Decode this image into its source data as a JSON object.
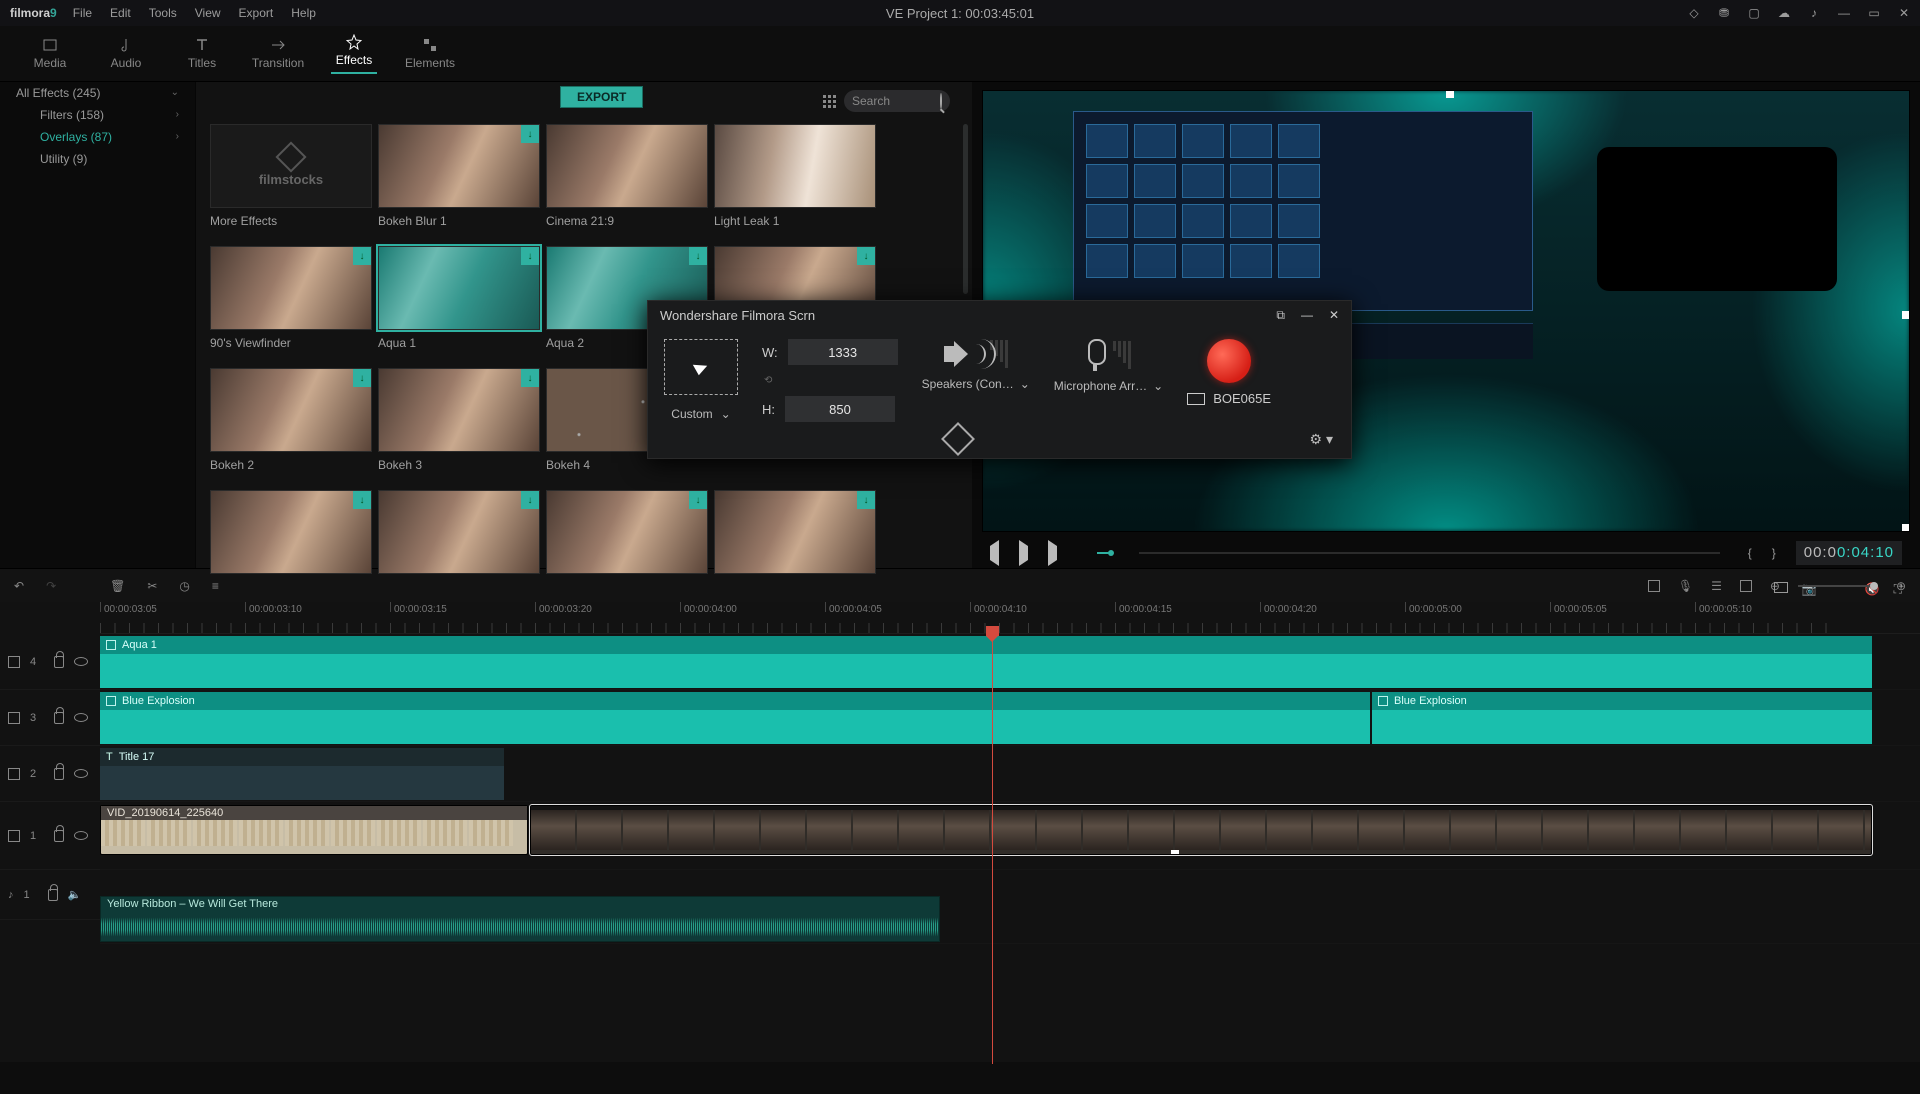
{
  "app": {
    "logo_a": "filmora",
    "logo_b": "9",
    "title": "VE Project 1:  00:03:45:01"
  },
  "menu": [
    "File",
    "Edit",
    "Tools",
    "View",
    "Export",
    "Help"
  ],
  "modes": [
    {
      "label": "Media"
    },
    {
      "label": "Audio"
    },
    {
      "label": "Titles"
    },
    {
      "label": "Transition"
    },
    {
      "label": "Effects"
    },
    {
      "label": "Elements"
    }
  ],
  "sidebar": [
    {
      "label": "All Effects (245)",
      "cls": ""
    },
    {
      "label": "Filters (158)",
      "cls": "sub"
    },
    {
      "label": "Overlays (87)",
      "cls": "sub on"
    },
    {
      "label": "Utility (9)",
      "cls": "sub"
    }
  ],
  "export_label": "EXPORT",
  "search": {
    "placeholder": "Search"
  },
  "thumbs": [
    {
      "label": "More Effects",
      "cls": "filmstocks",
      "text": "filmstocks",
      "dl": false
    },
    {
      "label": "Bokeh Blur 1",
      "cls": "",
      "dl": true
    },
    {
      "label": "Cinema 21:9",
      "cls": "",
      "dl": false
    },
    {
      "label": "Light Leak 1",
      "cls": "light",
      "dl": false
    },
    {
      "label": "90's Viewfinder",
      "cls": "",
      "dl": true
    },
    {
      "label": "Aqua 1",
      "cls": "aqua sel",
      "dl": true
    },
    {
      "label": "Aqua 2",
      "cls": "aqua",
      "dl": true
    },
    {
      "label": "",
      "cls": "",
      "dl": true
    },
    {
      "label": "Bokeh 2",
      "cls": "",
      "dl": true
    },
    {
      "label": "Bokeh 3",
      "cls": "",
      "dl": true
    },
    {
      "label": "Bokeh 4",
      "cls": "b4",
      "dl": false
    },
    {
      "label": "",
      "cls": "",
      "dl": false,
      "hidden": true
    },
    {
      "label": "",
      "cls": "",
      "dl": true
    },
    {
      "label": "",
      "cls": "",
      "dl": true
    },
    {
      "label": "",
      "cls": "",
      "dl": true
    },
    {
      "label": "",
      "cls": "",
      "dl": true
    }
  ],
  "scrn": {
    "title": "Wondershare Filmora Scrn",
    "w_label": "W:",
    "w_val": "1333",
    "h_label": "H:",
    "h_val": "850",
    "capture_mode": "Custom",
    "speakers": "Speakers (Con…",
    "mic": "Microphone Arr…",
    "monitor": "BOE065E"
  },
  "preview": {
    "timecode_a": "00:0",
    "timecode_b": "0:04:10"
  },
  "ruler": [
    "00:00:03:05",
    "00:00:03:10",
    "00:00:03:15",
    "00:00:03:20",
    "00:00:04:00",
    "00:00:04:05",
    "00:00:04:10",
    "00:00:04:15",
    "00:00:04:20",
    "00:00:05:00",
    "00:00:05:05",
    "00:00:05:10"
  ],
  "track_heads": [
    {
      "type": "fx",
      "n": "4"
    },
    {
      "type": "fx",
      "n": "3"
    },
    {
      "type": "txt",
      "n": "2"
    },
    {
      "type": "vid",
      "n": "1"
    },
    {
      "type": "aud",
      "n": "1"
    }
  ],
  "clips": {
    "t4": {
      "label": "Aqua 1"
    },
    "t3a": {
      "label": "Blue Explosion"
    },
    "t3b": {
      "label": "Blue Explosion"
    },
    "t2": {
      "label": "Title 17"
    },
    "vid": {
      "label": "VID_20190614_225640"
    },
    "aud": {
      "label": "Yellow Ribbon – We Will Get There"
    }
  }
}
